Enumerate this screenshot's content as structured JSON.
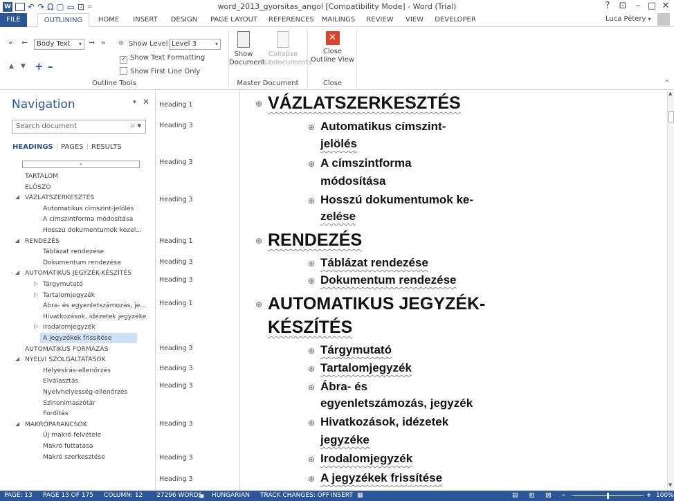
{
  "window": {
    "title": "word_2013_gyorsitas_angol [Compatibility Mode] - Word (Trial)",
    "help": "?",
    "ribbon_display": "⊡",
    "minimize": "–",
    "maximize": "□",
    "close": "✕"
  },
  "qat": {
    "app_icon": "W",
    "save": "💾",
    "undo": "↶",
    "redo": "↷",
    "omega": "Ω",
    "new": "▢",
    "format": "▭",
    "preview": "⊡",
    "more": "="
  },
  "tabs": [
    "FILE",
    "OUTLINING",
    "HOME",
    "INSERT",
    "DESIGN",
    "PAGE LAYOUT",
    "REFERENCES",
    "MAILINGS",
    "REVIEW",
    "VIEW",
    "DEVELOPER"
  ],
  "active_tab": "OUTLINING",
  "user": {
    "name": "Luca Pétery",
    "caret": "▾"
  },
  "ribbon": {
    "outline_tools": {
      "label": "Outline Tools",
      "level_value": "Body Text",
      "show_level_label": "Show Level:",
      "show_level_value": "Level 3",
      "show_text_formatting": "Show Text Formatting",
      "show_first_line_only": "Show First Line Only",
      "promote_heading": "«",
      "promote": "←",
      "demote": "→",
      "demote_body": "»",
      "move_up": "▲",
      "move_down": "▼",
      "expand": "+",
      "collapse": "–"
    },
    "master_document": {
      "label": "Master Document",
      "show_document": "Show Document",
      "show_document_l1": "Show",
      "show_document_l2": "Document",
      "collapse_l1": "Collapse",
      "collapse_l2": "Subdocuments"
    },
    "close_group": {
      "label": "Close",
      "close_l1": "Close",
      "close_l2": "Outline View",
      "close_icon": "✕"
    },
    "collapse_ribbon": "^"
  },
  "nav": {
    "title": "Navigation",
    "dropdown": "▾",
    "close": "✕",
    "search_placeholder": "Search document",
    "search_icon": "⌕ ▾",
    "tabs": [
      "HEADINGS",
      "PAGES",
      "RESULTS"
    ],
    "tab_sep": "|",
    "collapse_marker": "⌅",
    "items": [
      {
        "label": "TARTALOM",
        "level": 1,
        "tri": ""
      },
      {
        "label": "ELŐSZÓ",
        "level": 1,
        "tri": ""
      },
      {
        "label": "VÁZLATSZERKESZTÉS",
        "level": 1,
        "tri": "◢"
      },
      {
        "label": "Automatikus címszint-jelölés",
        "level": 3,
        "tri": ""
      },
      {
        "label": "A címszintforma módosítása",
        "level": 3,
        "tri": ""
      },
      {
        "label": "Hosszú dokumentumok kezel...",
        "level": 3,
        "tri": ""
      },
      {
        "label": "RENDEZÉS",
        "level": 1,
        "tri": "◢"
      },
      {
        "label": "Táblázat rendezése",
        "level": 3,
        "tri": ""
      },
      {
        "label": "Dokumentum rendezése",
        "level": 3,
        "tri": ""
      },
      {
        "label": "AUTOMATIKUS JEGYZÉK-KÉSZÍTÉS",
        "level": 1,
        "tri": "◢"
      },
      {
        "label": "Tárgymutató",
        "level": 2,
        "tri": "▷"
      },
      {
        "label": "Tartalomjegyzék",
        "level": 2,
        "tri": "▷"
      },
      {
        "label": "Ábra- és egyenletszámozás, je...",
        "level": 3,
        "tri": ""
      },
      {
        "label": "Hivatkozások, idézetek jegyzéke",
        "level": 3,
        "tri": ""
      },
      {
        "label": "Irodalomjegyzék",
        "level": 2,
        "tri": "▷"
      },
      {
        "label": "A jegyzékek frissítése",
        "level": 3,
        "tri": "",
        "selected": true
      },
      {
        "label": "AUTOMATIKUS FORMÁZÁS",
        "level": 1,
        "tri": ""
      },
      {
        "label": "NYELVI SZOLGÁLTATÁSOK",
        "level": 1,
        "tri": "◢"
      },
      {
        "label": "Helyesírás-ellenőrzés",
        "level": 3,
        "tri": ""
      },
      {
        "label": "Elválasztás",
        "level": 3,
        "tri": ""
      },
      {
        "label": "Nyelvhelyesség-ellenőrzés",
        "level": 3,
        "tri": ""
      },
      {
        "label": "Szinonimaszótár",
        "level": 3,
        "tri": ""
      },
      {
        "label": "Fordítás",
        "level": 3,
        "tri": ""
      },
      {
        "label": "MAKRÓPARANCSOK",
        "level": 1,
        "tri": "◢"
      },
      {
        "label": "Új makró felvétele",
        "level": 3,
        "tri": ""
      },
      {
        "label": "Makró futtatása",
        "level": 3,
        "tri": ""
      },
      {
        "label": "Makró szerkesztése",
        "level": 3,
        "tri": ""
      }
    ]
  },
  "style_area": [
    "Heading 1",
    "Heading 3",
    "Heading 3",
    "Heading 3",
    "Heading 1",
    "Heading 3",
    "Heading 3",
    "Heading 1",
    "Heading 3",
    "Heading 3",
    "Heading 3",
    "Heading 3",
    "Heading 3",
    "Heading 3"
  ],
  "document": {
    "plus": "⊕",
    "lines": [
      "VÁZLATSZERKESZTÉS",
      "Automatikus címszint-",
      "jelölés",
      "A címszintforma",
      "módosítása",
      "Hosszú dokumentumok ke-",
      "zelése",
      "RENDEZÉS",
      "Táblázat rendezése",
      "Dokumentum rendezése",
      "AUTOMATIKUS JEGYZÉK-",
      "KÉSZÍTÉS",
      "Tárgymutató",
      "Tartalomjegyzék",
      "Ábra- és",
      "egyenletszámozás, jegyzék",
      "Hivatkozások, idézetek",
      "jegyzéke",
      "Irodalomjegyzék",
      "A jegyzékek frissítése"
    ]
  },
  "status": {
    "page": "PAGE: 13",
    "page_of": "PAGE 13 OF 175",
    "column": "COLUMN: 12",
    "words": "27296 WORDS",
    "proof_icon": "📖",
    "language": "HUNGARIAN",
    "track_changes": "TRACK CHANGES: OFF",
    "insert": "INSERT",
    "macro_icon": "▦",
    "view_read": "▤",
    "view_print": "▥",
    "view_web": "▧",
    "zoom_minus": "–",
    "zoom_plus": "+",
    "zoom": "100%",
    "zoom_level": 0.5
  },
  "colors": {
    "accent": "#2b579a",
    "nav_selected": "#cde0f7",
    "close_red": "#d9452b"
  }
}
